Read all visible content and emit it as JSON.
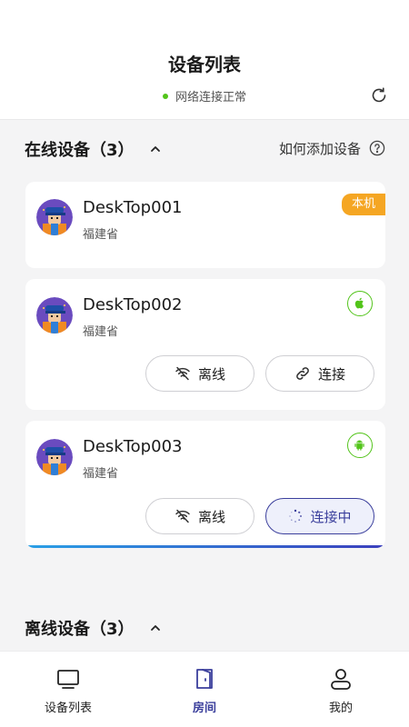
{
  "header": {
    "title": "设备列表",
    "status_text": "网络连接正常",
    "status_color": "#52c41a",
    "refresh_icon": "refresh-icon"
  },
  "online_section": {
    "title": "在线设备（3）",
    "add_link": "如何添加设备"
  },
  "devices": [
    {
      "name": "DeskTop001",
      "region": "福建省",
      "badge": "本机"
    },
    {
      "name": "DeskTop002",
      "region": "福建省",
      "os": "apple-icon",
      "offline_label": "离线",
      "connect_label": "连接"
    },
    {
      "name": "DeskTop003",
      "region": "福建省",
      "os": "android-icon",
      "offline_label": "离线",
      "connect_label": "连接中"
    }
  ],
  "offline_section": {
    "title": "离线设备（3）"
  },
  "nav": {
    "items": [
      {
        "label": "设备列表",
        "icon": "monitor-icon"
      },
      {
        "label": "房间",
        "icon": "door-icon"
      },
      {
        "label": "我的",
        "icon": "user-icon"
      }
    ]
  },
  "colors": {
    "accent": "#3b3f9c",
    "badge": "#f5a623",
    "os_icon": "#52c41a"
  }
}
